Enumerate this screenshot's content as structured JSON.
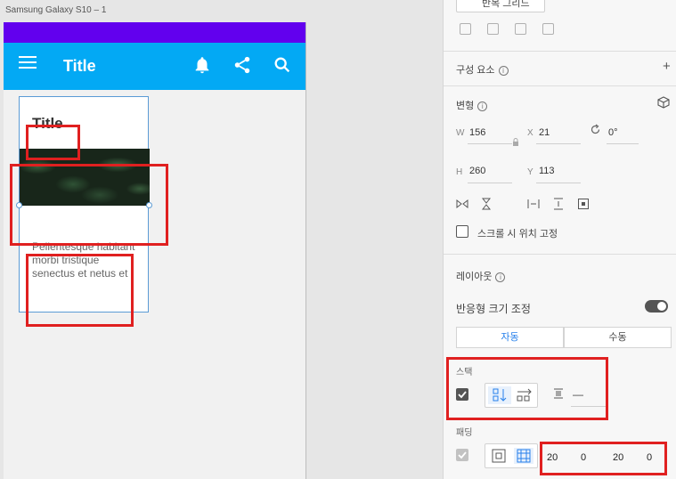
{
  "artboard": {
    "label": "Samsung Galaxy S10 – 1"
  },
  "appbar": {
    "title": "Title",
    "icons": [
      "menu-icon",
      "bell-icon",
      "share-icon",
      "search-icon"
    ]
  },
  "card": {
    "title": "Title",
    "body": "Pellentesque habitant morbi tristique senectus et netus et",
    "image": "leaves-image"
  },
  "panel": {
    "top_button_label": "반복 그리드",
    "components": {
      "label": "구성 요소",
      "add": "+"
    },
    "transform": {
      "label": "변형",
      "w_label": "W",
      "w_value": "156",
      "x_label": "X",
      "x_value": "21",
      "rotation_value": "0°",
      "h_label": "H",
      "h_value": "260",
      "y_label": "Y",
      "y_value": "113",
      "fix_scroll_label": "스크롤 시 위치 고정"
    },
    "layout": {
      "label": "레이아웃",
      "responsive_label": "반응형 크기 조정",
      "responsive_on": true,
      "tab_auto": "자동",
      "tab_manual": "수동",
      "stack_label": "스택",
      "stack_spacing": "—",
      "padding_label": "패딩",
      "padding_values": [
        "20",
        "0",
        "20",
        "0"
      ]
    },
    "accent_color": "#2680eb"
  },
  "highlight_color": "#e02020"
}
